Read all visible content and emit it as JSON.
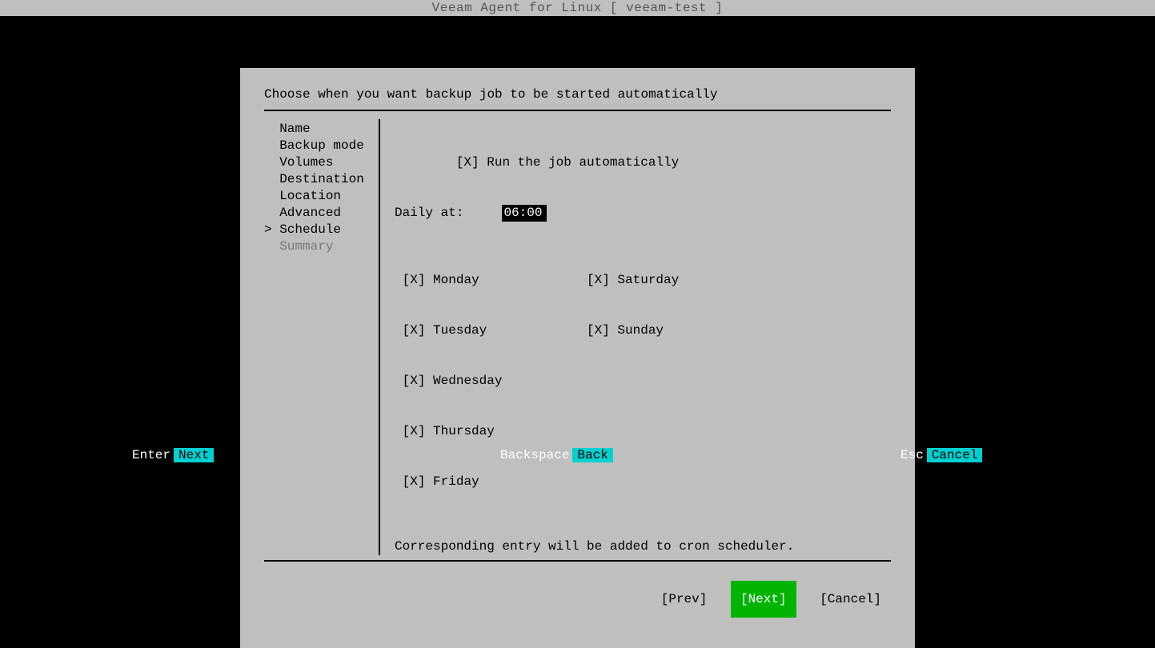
{
  "titlebar": "Veeam Agent for Linux   [ veeam-test ]",
  "dialog": {
    "header": "Choose when you want backup job to be started automatically",
    "sidebar": {
      "items": [
        {
          "label": "Name"
        },
        {
          "label": "Backup mode"
        },
        {
          "label": "Volumes"
        },
        {
          "label": "Destination"
        },
        {
          "label": "Location"
        },
        {
          "label": "Advanced"
        },
        {
          "label": "Schedule"
        },
        {
          "label": "Summary"
        }
      ]
    },
    "content": {
      "run_auto_check": "[X]",
      "run_auto_label": "Run the job automatically",
      "daily_label": "Daily at:",
      "daily_time": "06:00",
      "days_col1": [
        {
          "check": "[X]",
          "label": "Monday"
        },
        {
          "check": "[X]",
          "label": "Tuesday"
        },
        {
          "check": "[X]",
          "label": "Wednesday"
        },
        {
          "check": "[X]",
          "label": "Thursday"
        },
        {
          "check": "[X]",
          "label": "Friday"
        }
      ],
      "days_col2": [
        {
          "check": "[X]",
          "label": "Saturday"
        },
        {
          "check": "[X]",
          "label": "Sunday"
        }
      ],
      "note": "Corresponding entry will be added to cron scheduler."
    },
    "footer": {
      "prev": "[Prev]",
      "next": "[Next]",
      "cancel": "[Cancel]"
    }
  },
  "bottombar": {
    "enter_key": "Enter",
    "enter_action": "Next",
    "back_key": "Backspace",
    "back_action": "Back",
    "esc_key": "Esc",
    "esc_action": "Cancel"
  }
}
